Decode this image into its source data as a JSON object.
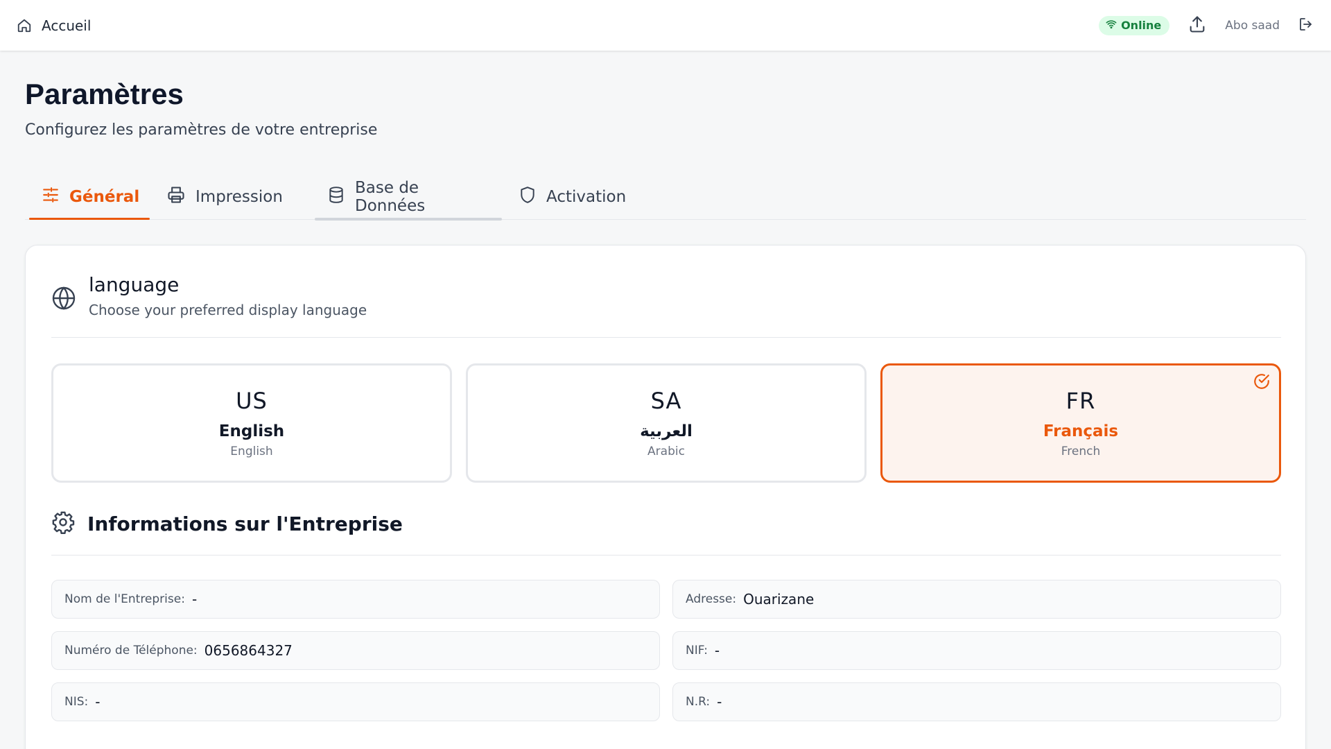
{
  "topbar": {
    "home_label": "Accueil",
    "status": "Online",
    "username": "Abo saad"
  },
  "page": {
    "title": "Paramètres",
    "subtitle": "Configurez les paramètres de votre entreprise"
  },
  "tabs": [
    {
      "label": "Général",
      "icon": "sliders-icon",
      "active": true
    },
    {
      "label": "Impression",
      "icon": "printer-icon",
      "active": false
    },
    {
      "label": "Base de Données",
      "icon": "database-icon",
      "active": false
    },
    {
      "label": "Activation",
      "icon": "shield-icon",
      "active": false
    }
  ],
  "language_section": {
    "title": "language",
    "description": "Choose your preferred display language",
    "options": [
      {
        "code": "US",
        "name": "English",
        "sub": "English",
        "selected": false
      },
      {
        "code": "SA",
        "name": "العربية",
        "sub": "Arabic",
        "selected": false
      },
      {
        "code": "FR",
        "name": "Français",
        "sub": "French",
        "selected": true
      }
    ]
  },
  "company_section": {
    "title": "Informations sur l'Entreprise",
    "fields": [
      {
        "label": "Nom de l'Entreprise:",
        "value": "-"
      },
      {
        "label": "Adresse:",
        "value": "Ouarizane"
      },
      {
        "label": "Numéro de Téléphone:",
        "value": "0656864327"
      },
      {
        "label": "NIF:",
        "value": "-"
      },
      {
        "label": "NIS:",
        "value": "-"
      },
      {
        "label": "N.R:",
        "value": "-"
      }
    ]
  },
  "colors": {
    "accent": "#ea580c",
    "online_bg": "#dcfce7",
    "online_text": "#15803d",
    "selected_bg": "#fdf3ee"
  }
}
